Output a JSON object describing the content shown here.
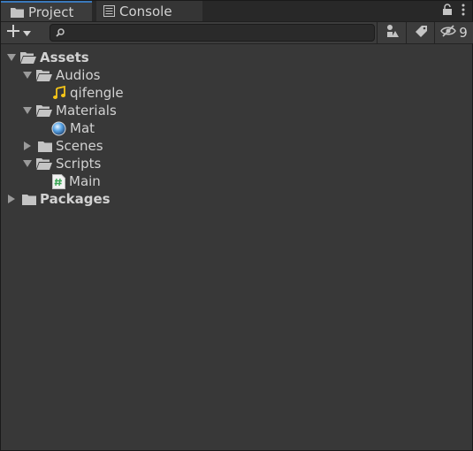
{
  "tabs": [
    {
      "label": "Project",
      "icon": "folder-icon",
      "active": true
    },
    {
      "label": "Console",
      "icon": "console-icon",
      "active": false
    }
  ],
  "toolbar": {
    "search_value": "",
    "hidden_count": "9"
  },
  "tree": {
    "assets": "Assets",
    "audios": "Audios",
    "qifengle": "qifengle",
    "materials": "Materials",
    "mat": "Mat",
    "scenes": "Scenes",
    "scripts": "Scripts",
    "main": "Main",
    "packages": "Packages"
  },
  "colors": {
    "accent": "#3a79bb",
    "panel_bg": "#383838",
    "audio_icon": "#f5c518",
    "material_icon": "#5aa6e8",
    "script_icon": "#3aa655"
  }
}
